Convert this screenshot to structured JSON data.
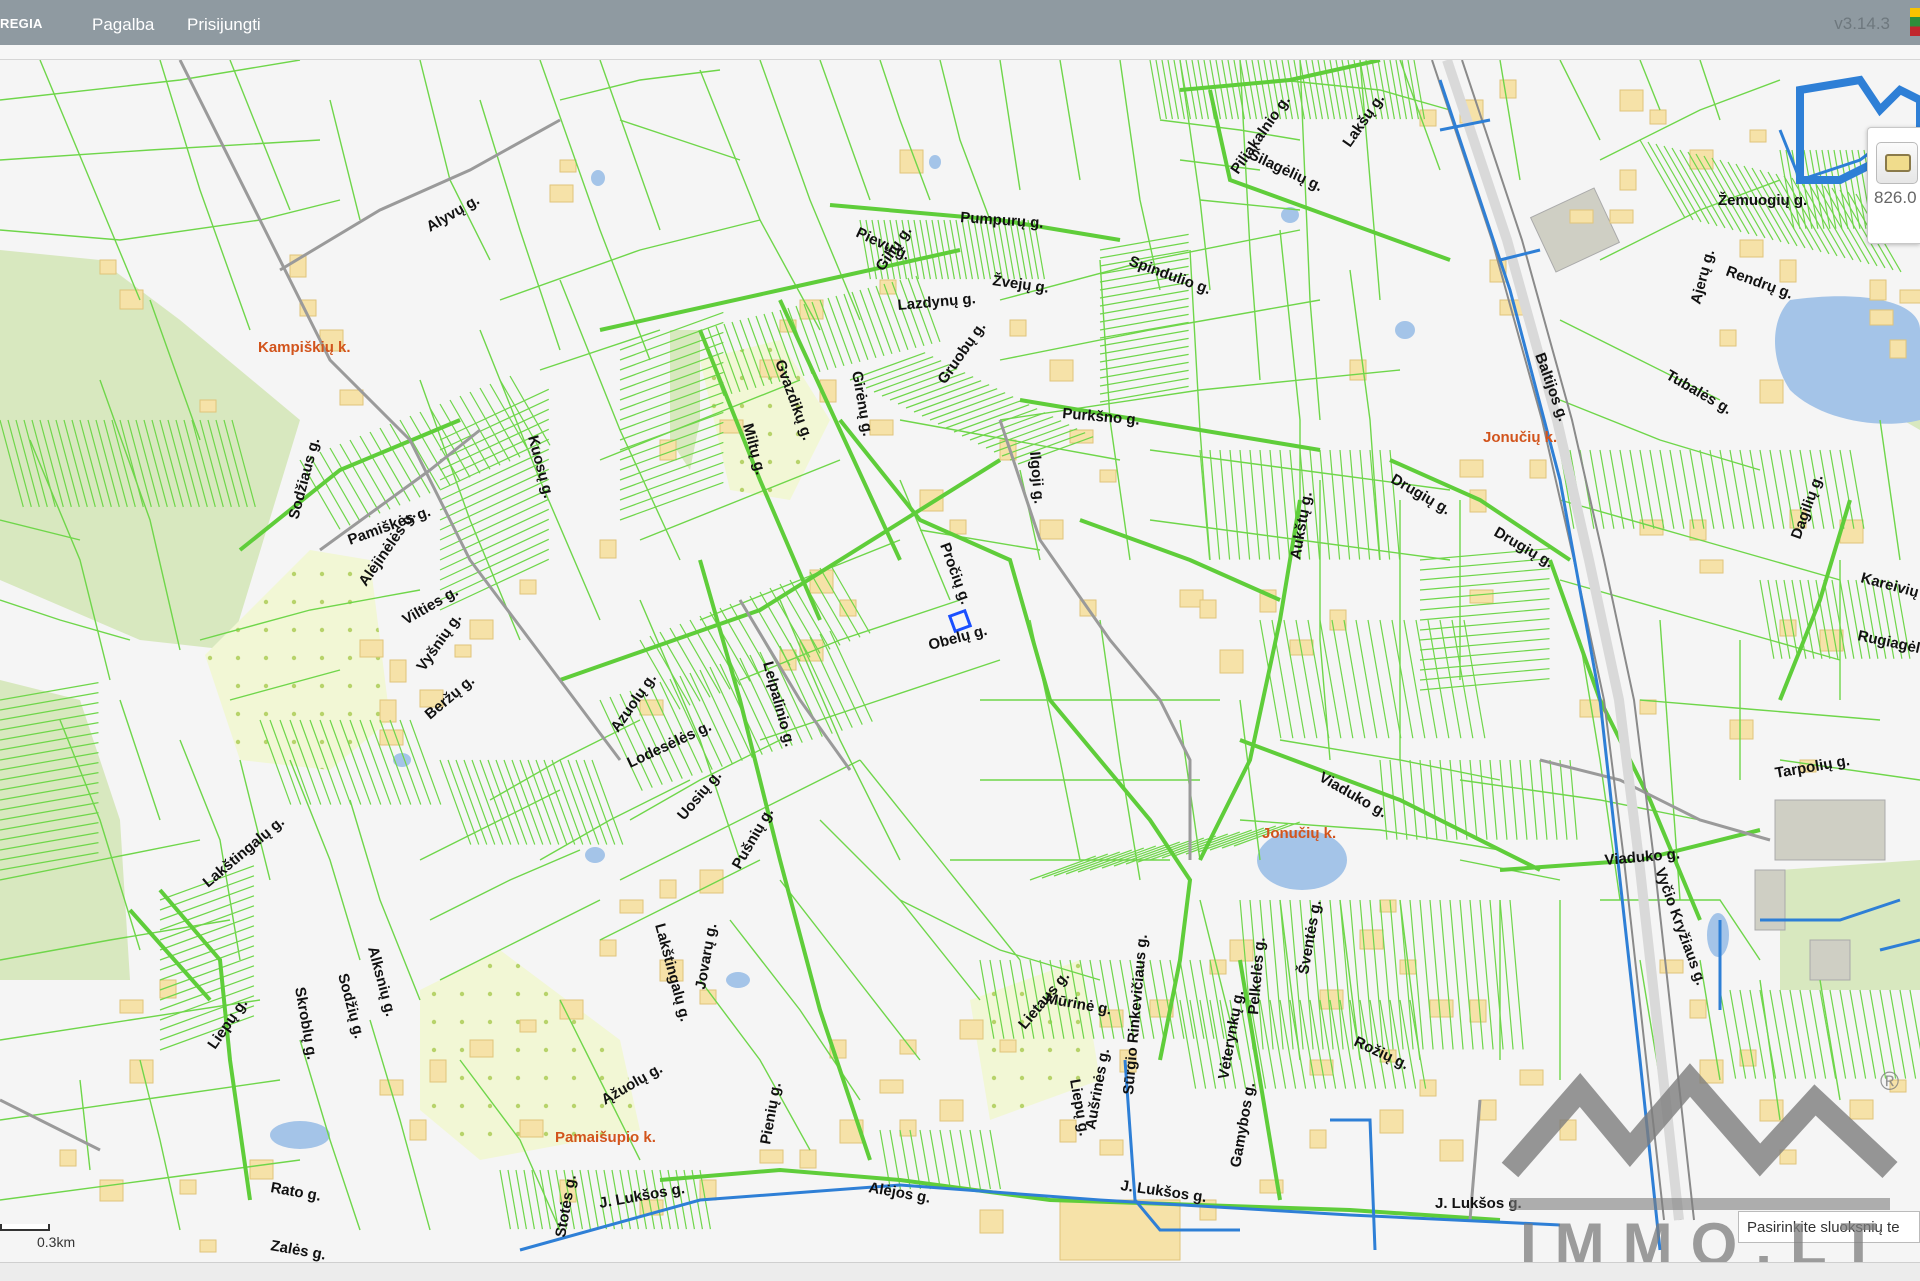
{
  "topbar": {
    "brand": "REGIA",
    "nav": [
      "Pagalba",
      "Prisijungti"
    ],
    "version": "v3.14.3"
  },
  "tool_panel": {
    "icon": "layer-switch-icon",
    "value": "826.0"
  },
  "scale": {
    "label": "0.3km"
  },
  "layer_hint": {
    "text": "Pasirinkite sluoksnių te"
  },
  "watermark": {
    "text": "IMMO.LT",
    "mark": "®"
  },
  "map": {
    "colors": {
      "parcel_line": "#6fd64a",
      "road_line": "#999999",
      "meadow": "#d8e8bf",
      "orchard": "#f2f7d5",
      "building": "#f6e2a8",
      "water": "#a4c4e8",
      "utility_line": "#2e7fd6",
      "village_label": "#d2541c"
    },
    "villages": [
      "Kampiškių k.",
      "Jonučių k.",
      "Jonučių k.",
      "Pamaišupio k."
    ],
    "streets": [
      "Alyvų g.",
      "Pumpurų g.",
      "Piliakalnio g.",
      "Šilagėlių g.",
      "Lakšų g.",
      "Pievų g.",
      "Gilių g.",
      "Lazdynų g.",
      "Žvejų g.",
      "Spindulio g.",
      "Žemuogių g.",
      "Rendrų g.",
      "Ajerų g.",
      "Tubalės g.",
      "Baltijos g.",
      "Purkšno g.",
      "Gvazdikų g.",
      "Girėnų g.",
      "Gruobų g.",
      "Miltų g.",
      "Kuosų g.",
      "Sodžiaus g.",
      "Pamiškės g.",
      "Alėjinėlės g.",
      "Vilties g.",
      "Vyšnių g.",
      "Beržų g.",
      "Ilgoji g.",
      "Pročių g.",
      "Obelų g.",
      "Aukštų g.",
      "Drugių g.",
      "Drugių g.",
      "Lelpalinio g.",
      "Azuolų g.",
      "Lodesėlės g.",
      "Uosių g.",
      "Viaduko g.",
      "Viaduko g.",
      "Vyčio Kryžiaus g.",
      "Dagilių g.",
      "Kareivių g.",
      "Rugiagėlių g.",
      "Tarpolių g.",
      "Pušnių g.",
      "Lakštingalų g.",
      "Lakštingalų g.",
      "Jovarų g.",
      "Alksnių g.",
      "Sodžių g.",
      "Skroblų g.",
      "Liepų g.",
      "Lietaus g.",
      "Mūrinė g.",
      "Pelkelės g.",
      "Vėterynkų g.",
      "Sūrgio Rinkevičiaus g.",
      "Šventės g.",
      "Rožių g.",
      "Gamybos g.",
      "Aušrinės g.",
      "J. Lukšos g.",
      "J. Lukšos g.",
      "J. Lukšos g.",
      "Rato g.",
      "Zalės g.",
      "Stotės g.",
      "Alėjos g.",
      "Pienių g.",
      "Liepų g.",
      "Ąžuolų g."
    ]
  }
}
